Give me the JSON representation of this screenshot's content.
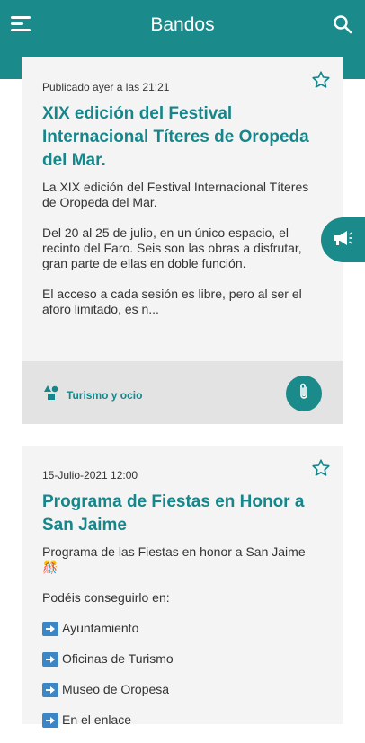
{
  "header": {
    "title": "Bandos"
  },
  "bandos": [
    {
      "date": "Publicado ayer a las 21:21",
      "title": "XIX edición del Festival Internacional Títeres de Oropeda del Mar.",
      "paragraphs": [
        "La XIX edición del Festival Internacional Títeres de Oropeda del Mar.",
        "Del  20 al 25 de julio, en un único espacio, el recinto del Faro. Seis son las obras a disfrutar, gran parte de ellas en doble función.",
        "El acceso a cada sesión es libre, pero al ser el aforo limitado, es n..."
      ],
      "category": "Turismo y ocio"
    },
    {
      "date": "15-Julio-2021 12:00",
      "title": "Programa de Fiestas en Honor a San Jaime",
      "paragraphs": [
        "Programa de las Fiestas en honor a San Jaime🎊",
        "Podéis conseguirlo en:"
      ],
      "list_items": [
        "Ayuntamiento",
        "Oficinas de Turismo",
        "Museo de Oropesa",
        "En el enlace"
      ]
    }
  ]
}
